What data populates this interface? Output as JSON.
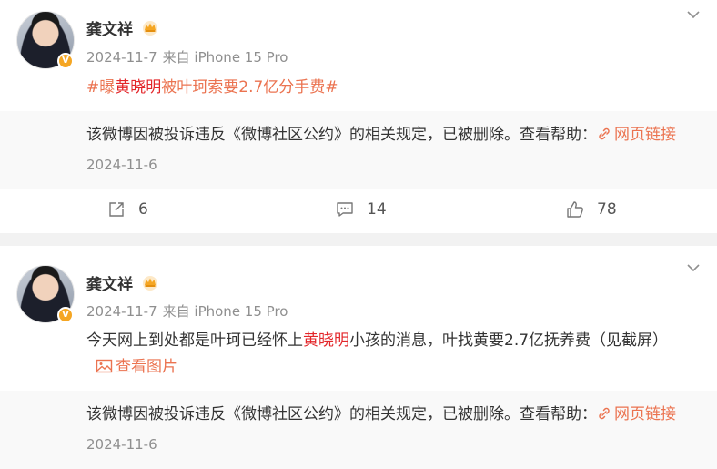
{
  "posts": [
    {
      "author": "龚文祥",
      "meta_date": "2024-11-7",
      "meta_source": "来自 iPhone 15 Pro",
      "topic_prefix": "#曝",
      "topic_name": "黄晓明",
      "topic_suffix": "被叶珂索要2.7亿分手费#",
      "notice": {
        "text": "该微博因被投诉违反《微博社区公约》的相关规定，已被删除。查看帮助：",
        "link": "网页链接",
        "date": "2024-11-6"
      },
      "actions": {
        "repost": "6",
        "comment": "14",
        "like": "78"
      }
    },
    {
      "author": "龚文祥",
      "meta_date": "2024-11-7",
      "meta_source": "来自 iPhone 15 Pro",
      "text_before": "今天网上到处都是叶珂已经怀上",
      "text_name": "黄晓明",
      "text_after": "小孩的消息，叶找黄要2.7亿抚养费（见截屏）",
      "image_link": "查看图片",
      "notice": {
        "text": "该微博因被投诉违反《微博社区公约》的相关规定，已被删除。查看帮助：",
        "link": "网页链接",
        "date": "2024-11-6"
      }
    }
  ],
  "colors": {
    "accent": "#eb7350",
    "highlight": "#e3262a",
    "verified": "#f5a623"
  },
  "icons": [
    "chevron-down-icon",
    "crown-icon",
    "verified-icon",
    "link-icon",
    "repost-icon",
    "comment-icon",
    "like-icon",
    "image-icon"
  ]
}
